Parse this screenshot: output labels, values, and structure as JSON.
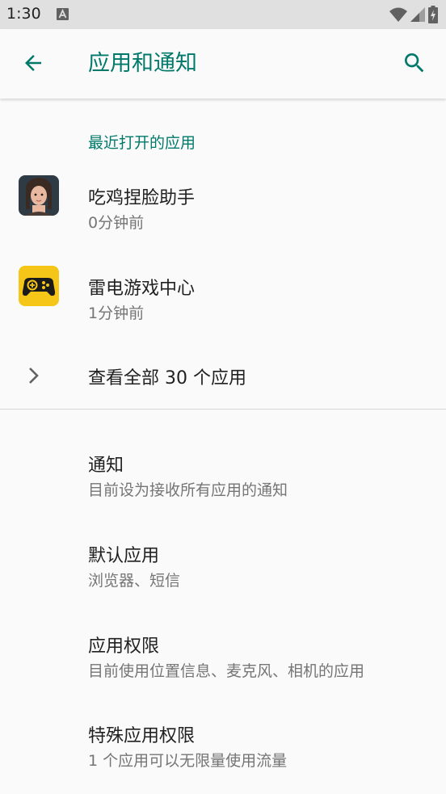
{
  "status_bar": {
    "time": "1:30",
    "icons": [
      "a-notification-icon",
      "wifi-icon",
      "signal-icon",
      "battery-charging-icon"
    ]
  },
  "app_bar": {
    "title": "应用和通知",
    "back_icon": "arrow-back-icon",
    "search_icon": "search-icon"
  },
  "recent": {
    "header": "最近打开的应用",
    "apps": [
      {
        "name": "吃鸡捏脸助手",
        "time": "0分钟前",
        "icon": "avatar-face-icon"
      },
      {
        "name": "雷电游戏中心",
        "time": "1分钟前",
        "icon": "gamepad-icon"
      }
    ],
    "see_all": "查看全部 30 个应用"
  },
  "settings": [
    {
      "title": "通知",
      "subtitle": "目前设为接收所有应用的通知"
    },
    {
      "title": "默认应用",
      "subtitle": "浏览器、短信"
    },
    {
      "title": "应用权限",
      "subtitle": "目前使用位置信息、麦克风、相机的应用"
    },
    {
      "title": "特殊应用权限",
      "subtitle": "1 个应用可以无限量使用流量"
    }
  ],
  "colors": {
    "accent": "#00796b",
    "status_bar": "#e0e0e0",
    "background": "#fafafa",
    "gamepad_bg": "#f5c518"
  }
}
